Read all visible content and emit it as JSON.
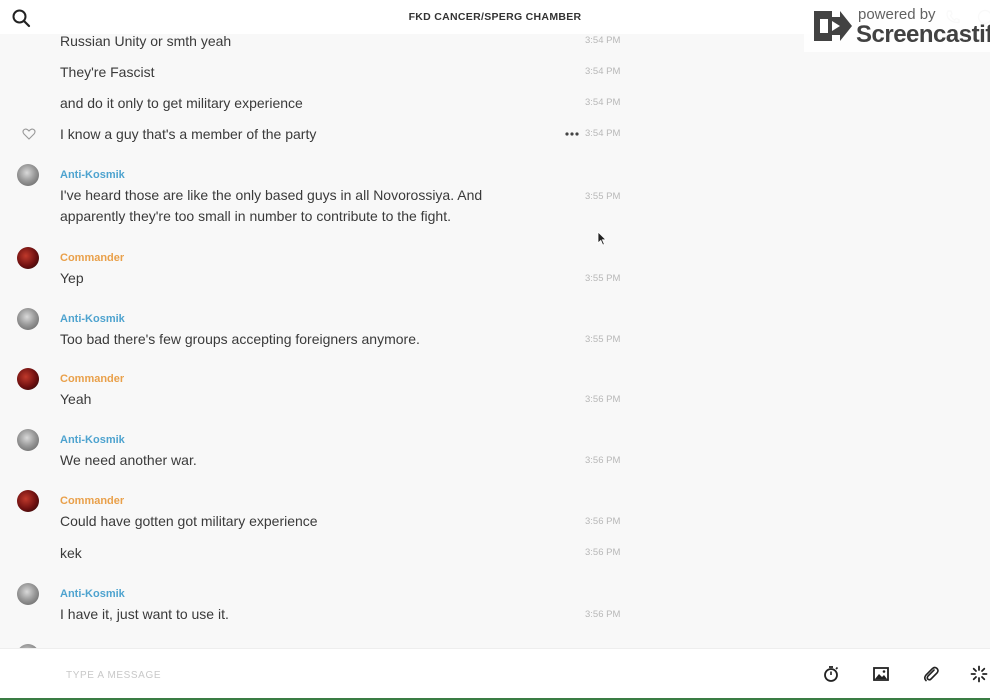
{
  "header": {
    "title": "FKD CANCER/SPERG CHAMBER"
  },
  "watermark": {
    "line1": "powered by",
    "line2": "Screencastify"
  },
  "composer": {
    "placeholder": "TYPE A MESSAGE"
  },
  "messages": [
    {
      "text": "Russian Unity or smth yeah",
      "time": "3:54 PM"
    },
    {
      "text": "They're Fascist",
      "time": "3:54 PM"
    },
    {
      "text": "and do it only to get military experience",
      "time": "3:54 PM"
    },
    {
      "text": "I know a guy that's a member of the party",
      "time": "3:54 PM"
    },
    {
      "author": "Anti-Kosmik",
      "text": "I've heard those are like the only based guys in all Novorossiya. And apparently they're too small in number to contribute to the fight.",
      "time": "3:55 PM"
    },
    {
      "author": "Commander",
      "text": "Yep",
      "time": "3:55 PM"
    },
    {
      "author": "Anti-Kosmik",
      "text": "Too bad there's few groups accepting foreigners anymore.",
      "time": "3:55 PM"
    },
    {
      "author": "Commander",
      "text": "Yeah",
      "time": "3:56 PM"
    },
    {
      "author": "Anti-Kosmik",
      "text": "We need another war.",
      "time": "3:56 PM"
    },
    {
      "author": "Commander",
      "text": "Could have gotten got military experience",
      "time": "3:56 PM"
    },
    {
      "text": "kek",
      "time": "3:56 PM"
    },
    {
      "author": "Anti-Kosmik",
      "text": "I have it, just want to use it.",
      "time": "3:56 PM"
    }
  ]
}
